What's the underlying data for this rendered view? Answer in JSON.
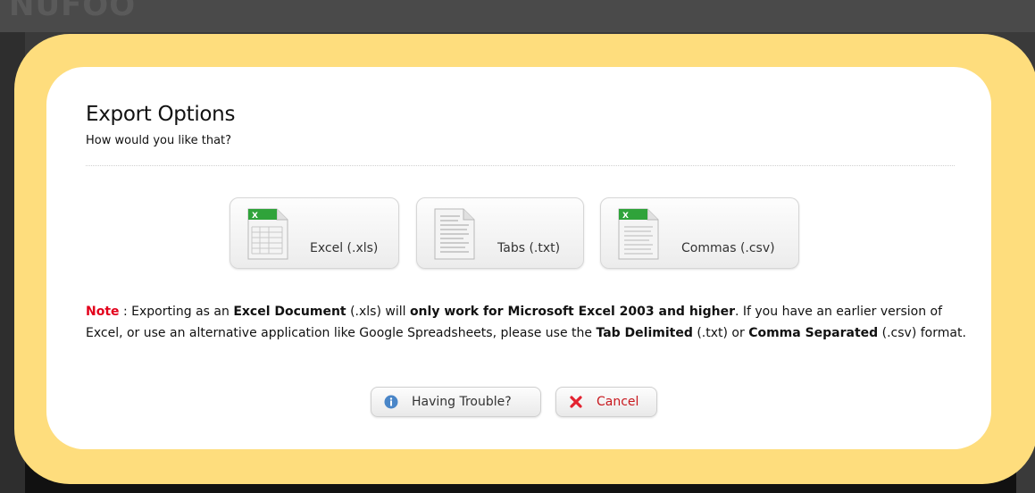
{
  "background": {
    "logo_text": "NUFOO"
  },
  "dialog": {
    "title": "Export Options",
    "subtitle": "How would you like that?",
    "export_buttons": [
      {
        "label": "Excel (.xls)",
        "icon": "excel-file-icon"
      },
      {
        "label": "Tabs (.txt)",
        "icon": "text-file-icon"
      },
      {
        "label": "Commas (.csv)",
        "icon": "csv-file-icon"
      }
    ],
    "note": {
      "label": "Note",
      "sep": " : ",
      "t1": "Exporting as an ",
      "b1": "Excel Document",
      "t2": " (.xls) will ",
      "b2": "only work for Microsoft Excel 2003 and higher",
      "t3": ". If you have an earlier version of Excel, or use an alternative application like Google Spreadsheets, please use the ",
      "b3": "Tab Delimited",
      "t4": " (.txt) or ",
      "b4": "Comma Separated",
      "t5": " (.csv) format."
    },
    "help_button": {
      "label": "Having Trouble?",
      "icon": "info-icon"
    },
    "cancel_button": {
      "label": "Cancel",
      "icon": "close-x-icon"
    }
  },
  "colors": {
    "modal_border": "#fedd7d",
    "note_red": "#e3001b",
    "cancel_red": "#c8181e",
    "excel_green": "#2fa33a"
  }
}
